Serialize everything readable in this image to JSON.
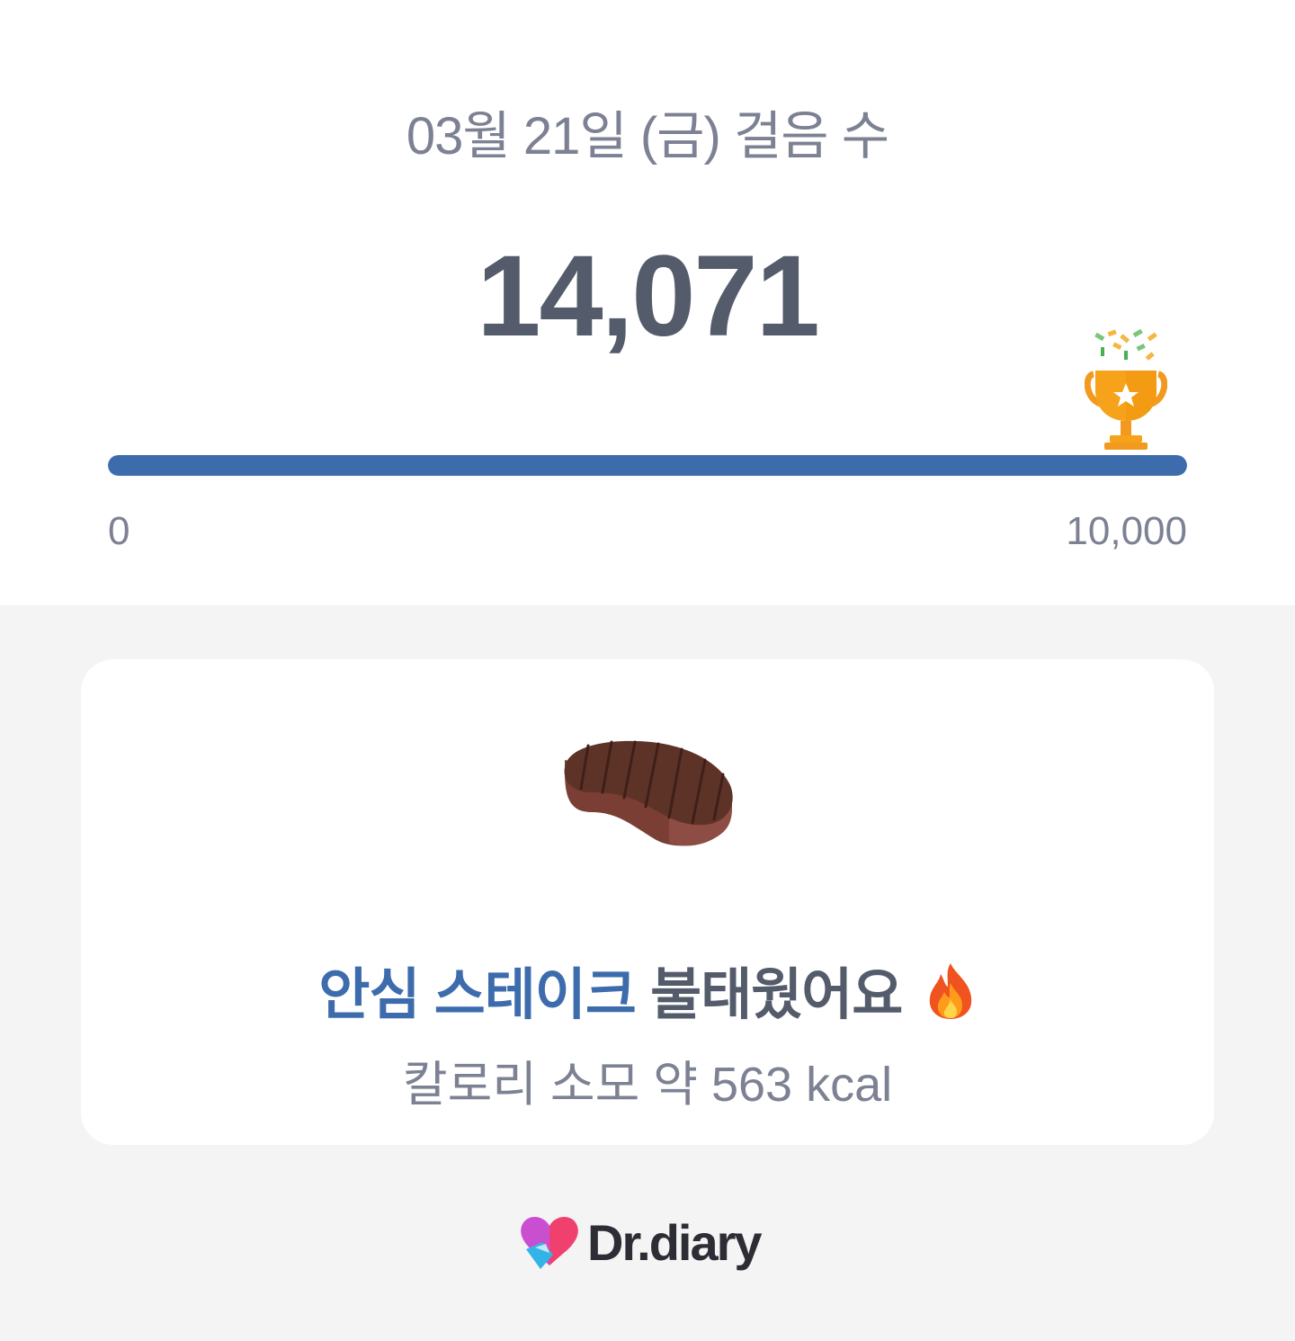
{
  "header": {
    "date_title": "03월 21일 (금) 걸음 수",
    "step_count": "14,071"
  },
  "progress": {
    "min_label": "0",
    "max_label": "10,000",
    "fill_fraction": 1.0,
    "color": "#3d6cad",
    "goal_icon": "trophy-icon"
  },
  "card": {
    "food_icon": "steak-icon",
    "food_name": "안심 스테이크",
    "burned_text": "불태웠어요",
    "emoji_icon": "fire-icon",
    "calorie_text": "칼로리 소모 약 563 kcal"
  },
  "brand": {
    "name": "Dr.diary",
    "logo_icon": "heart-logo-icon"
  }
}
